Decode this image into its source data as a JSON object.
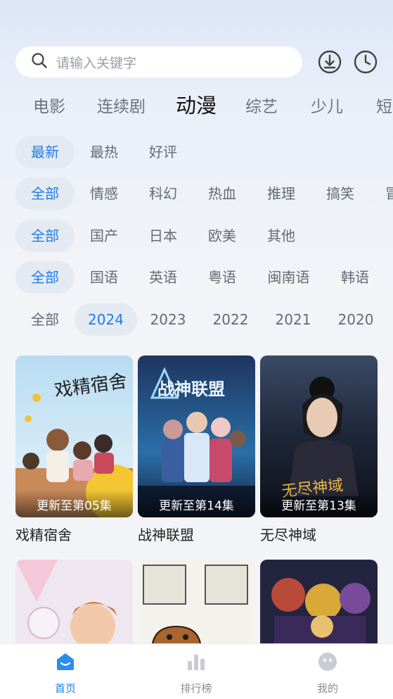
{
  "search": {
    "placeholder": "请输入关键字"
  },
  "category_tabs": [
    "电影",
    "连续剧",
    "动漫",
    "综艺",
    "少儿",
    "短"
  ],
  "filters": {
    "sort": [
      "最新",
      "最热",
      "好评"
    ],
    "genre": [
      "全部",
      "情感",
      "科幻",
      "热血",
      "推理",
      "搞笑",
      "冒"
    ],
    "region": [
      "全部",
      "国产",
      "日本",
      "欧美",
      "其他"
    ],
    "language": [
      "全部",
      "国语",
      "英语",
      "粤语",
      "闽南语",
      "韩语"
    ],
    "year": [
      "全部",
      "2024",
      "2023",
      "2022",
      "2021",
      "2020"
    ]
  },
  "cards": [
    {
      "title": "戏精宿舍",
      "episode": "更新至第05集"
    },
    {
      "title": "战神联盟",
      "episode": "更新至第14集"
    },
    {
      "title": "无尽神域",
      "episode": "更新至第13集"
    }
  ],
  "bottom_nav": [
    {
      "label": "首页",
      "icon": "home-icon"
    },
    {
      "label": "排行榜",
      "icon": "ranking-icon"
    },
    {
      "label": "我的",
      "icon": "profile-icon"
    }
  ],
  "colors": {
    "accent": "#1e7ee8",
    "chip_bg": "#e5e9f1",
    "background": "#f3f4f8"
  }
}
